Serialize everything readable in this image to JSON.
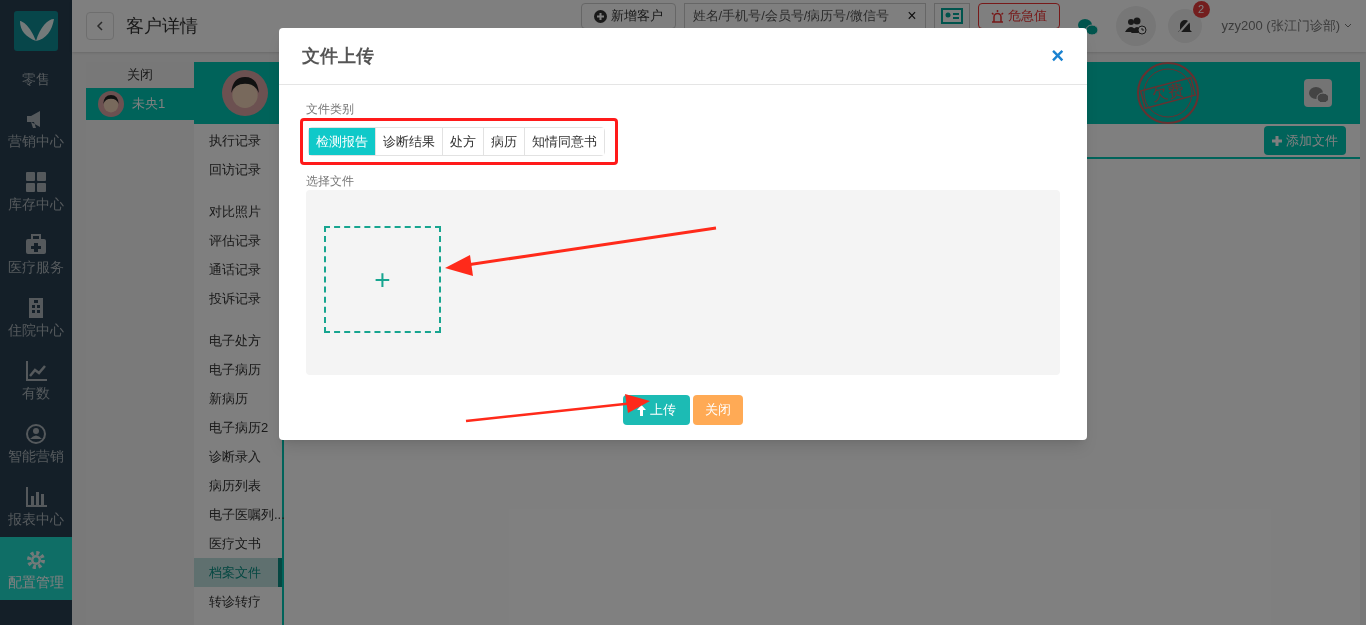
{
  "sidebar": {
    "items": [
      {
        "label": "零售",
        "selected": false
      },
      {
        "label": "营销中心",
        "selected": false
      },
      {
        "label": "库存中心",
        "selected": false
      },
      {
        "label": "医疗服务",
        "selected": false
      },
      {
        "label": "住院中心",
        "selected": false
      },
      {
        "label": "有数",
        "selected": false
      },
      {
        "label": "智能营销",
        "selected": false
      },
      {
        "label": "报表中心",
        "selected": false
      },
      {
        "label": "配置管理",
        "selected": true
      }
    ]
  },
  "header": {
    "title": "客户详情",
    "new_button": "新增客户",
    "search": {
      "placeholder": "姓名/手机号/会员号/病历号/微信号",
      "clear": "×"
    },
    "alert_button": "危急值",
    "notification_count": "2",
    "user": "yzy200 (张江门诊部)"
  },
  "customer_tabs": {
    "close": "关闭",
    "items": [
      {
        "name": "未央1",
        "selected": true
      }
    ]
  },
  "stamp": "欠费",
  "submenu": {
    "groups": [
      [
        {
          "label": "执行记录",
          "selected": false
        },
        {
          "label": "回访记录",
          "selected": false
        }
      ],
      [
        {
          "label": "对比照片",
          "selected": false
        },
        {
          "label": "评估记录",
          "selected": false
        },
        {
          "label": "通话记录",
          "selected": false
        },
        {
          "label": "投诉记录",
          "selected": false
        }
      ],
      [
        {
          "label": "电子处方",
          "selected": false
        },
        {
          "label": "电子病历",
          "selected": false
        },
        {
          "label": "新病历",
          "selected": false
        },
        {
          "label": "电子病历2",
          "selected": false
        },
        {
          "label": "诊断录入",
          "selected": false
        },
        {
          "label": "病历列表",
          "selected": false
        },
        {
          "label": "电子医嘱列...",
          "selected": false
        },
        {
          "label": "医疗文书",
          "selected": false
        },
        {
          "label": "档案文件",
          "selected": true
        },
        {
          "label": "转诊转疗",
          "selected": false
        }
      ]
    ]
  },
  "add_file_button": "添加文件",
  "dialog": {
    "title": "文件上传",
    "close": "×",
    "category_label": "文件类别",
    "categories": [
      {
        "label": "检测报告",
        "selected": true
      },
      {
        "label": "诊断结果",
        "selected": false
      },
      {
        "label": "处方",
        "selected": false
      },
      {
        "label": "病历",
        "selected": false
      },
      {
        "label": "知情同意书",
        "selected": false
      }
    ],
    "file_label": "选择文件",
    "add": "+",
    "upload_button": "上传",
    "close_button": "关闭"
  }
}
